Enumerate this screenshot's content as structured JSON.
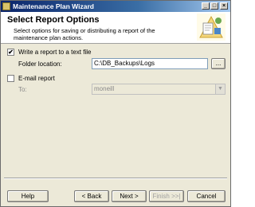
{
  "window": {
    "title": "Maintenance Plan Wizard"
  },
  "titlebar_buttons": {
    "minimize": "_",
    "maximize": "□",
    "close": "×"
  },
  "header": {
    "title": "Select Report Options",
    "subtitle": "Select options for saving or distributing a report of the maintenance plan actions."
  },
  "write_to_file": {
    "label": "Write a report to a text file",
    "checked": true,
    "mark": "✔"
  },
  "folder": {
    "label": "Folder location:",
    "value": "C:\\DB_Backups\\Logs",
    "browse_label": "..."
  },
  "email": {
    "label": "E-mail report",
    "checked": false
  },
  "to": {
    "label": "To:",
    "value": "moneill"
  },
  "buttons": {
    "help": "Help",
    "back": "< Back",
    "next": "Next >",
    "finish": "Finish >>|",
    "cancel": "Cancel"
  }
}
